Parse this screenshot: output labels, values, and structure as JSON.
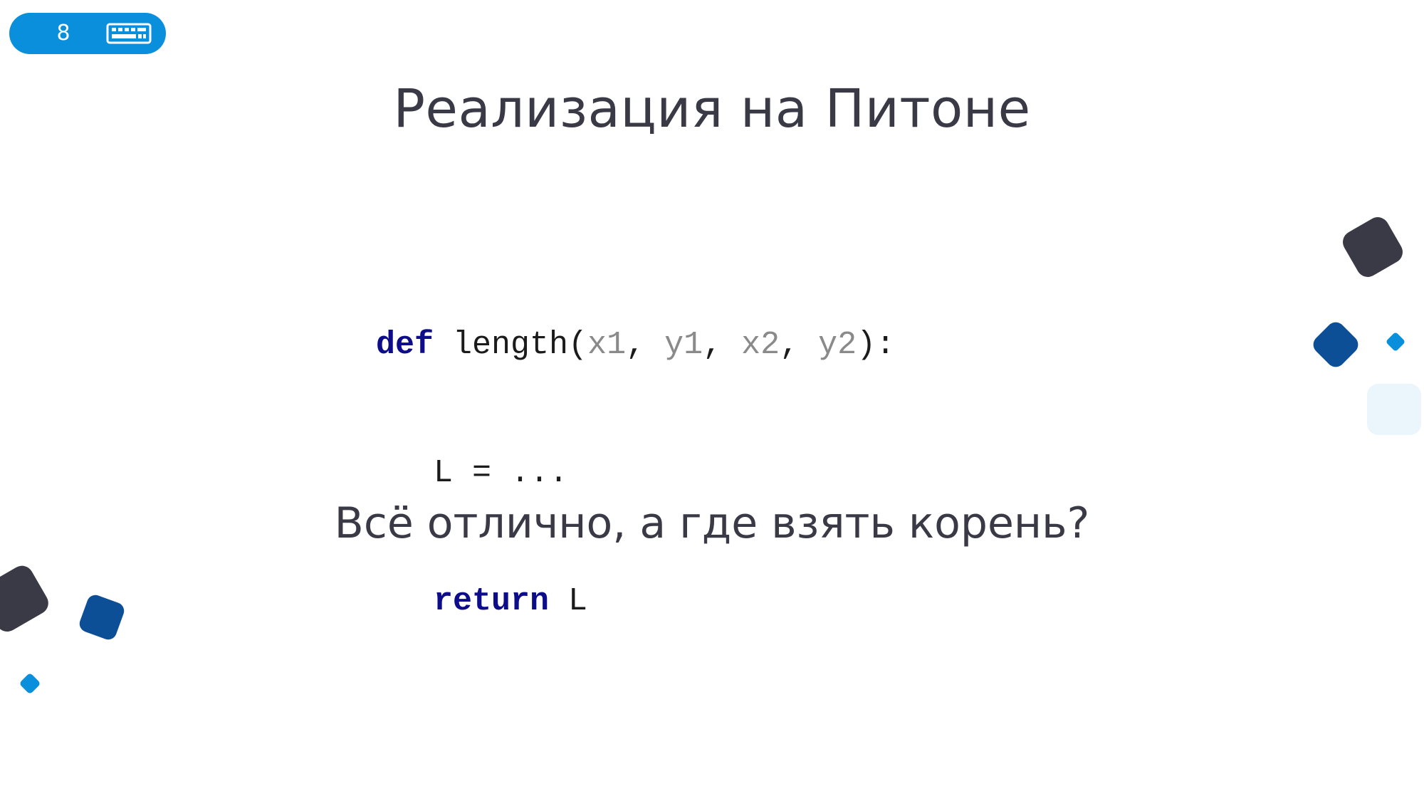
{
  "slide": {
    "number": "8",
    "title": "Реализация на Питоне",
    "question": "Всё отлично, а где взять корень?"
  },
  "code": {
    "line1": {
      "kw": "def",
      "fn": " length(",
      "a1": "x1",
      "s1": ", ",
      "a2": "y1",
      "s2": ", ",
      "a3": "x2",
      "s3": ", ",
      "a4": "y2",
      "end": "):"
    },
    "line2": "L = ...",
    "line3": {
      "kw": "return",
      "rest": " L"
    }
  },
  "icons": {
    "badge": "keyboard-icon"
  },
  "colors": {
    "accent": "#0a8fdc",
    "dark": "#3a3946",
    "navy": "#0d4f96",
    "keyword": "#0d0d8a",
    "argument": "#8a8a8a",
    "pale": "#eaf5fc"
  }
}
